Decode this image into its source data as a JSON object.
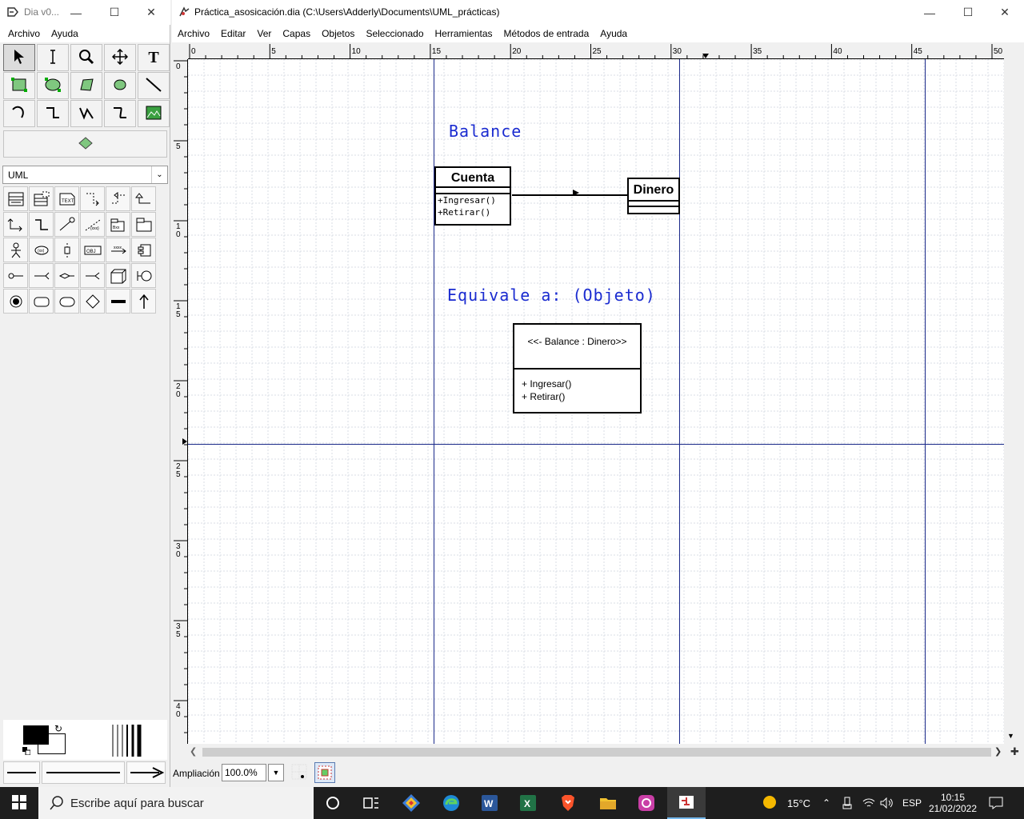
{
  "toolbox": {
    "title": "Dia v0...",
    "menu": [
      {
        "label": "Archivo"
      },
      {
        "label": "Ayuda"
      }
    ],
    "sheet": "UML",
    "tools": [
      {
        "icon": "pointer-icon"
      },
      {
        "icon": "text-cursor-icon"
      },
      {
        "icon": "magnify-icon"
      },
      {
        "icon": "move-icon"
      },
      {
        "icon": "text-tool-icon"
      },
      {
        "icon": "box-icon"
      },
      {
        "icon": "ellipse-icon"
      },
      {
        "icon": "polygon-icon"
      },
      {
        "icon": "beziergon-icon"
      },
      {
        "icon": "line-icon"
      },
      {
        "icon": "arc-icon"
      },
      {
        "icon": "zigzag-line-icon"
      },
      {
        "icon": "polyline-icon"
      },
      {
        "icon": "bezier-line-icon"
      },
      {
        "icon": "image-icon"
      }
    ],
    "wide_tool": "outline-icon"
  },
  "window": {
    "title": "Práctica_asosicación.dia (C:\\Users\\Adderly\\Documents\\UML_prácticas)",
    "menu": [
      {
        "label": "Archivo"
      },
      {
        "label": "Editar"
      },
      {
        "label": "Ver"
      },
      {
        "label": "Capas"
      },
      {
        "label": "Objetos"
      },
      {
        "label": "Seleccionado"
      },
      {
        "label": "Herramientas"
      },
      {
        "label": "Métodos de entrada"
      },
      {
        "label": "Ayuda"
      }
    ],
    "hruler_labels": [
      "0",
      "5",
      "10",
      "15",
      "20",
      "25",
      "30",
      "35",
      "40",
      "45",
      "50"
    ],
    "vruler_labels": [
      "0",
      "5",
      "10",
      "15",
      "20",
      "25",
      "30",
      "35",
      "40"
    ],
    "zoom_label": "Ampliación",
    "zoom_value": "100.0%"
  },
  "diagram": {
    "label1": "Balance",
    "label2": "Equivale a: (Objeto)",
    "class_cuenta": {
      "name": "Cuenta",
      "ops": [
        "+Ingresar()",
        "+Retirar()"
      ]
    },
    "class_dinero": {
      "name": "Dinero"
    },
    "object": {
      "name": "<<- Balance : Dinero>>",
      "ops": [
        "+ Ingresar()",
        "+ Retirar()"
      ]
    }
  },
  "taskbar": {
    "search_placeholder": "Escribe aquí para buscar",
    "temperature": "15°C",
    "language": "ESP",
    "time": "10:15",
    "date": "21/02/2022"
  }
}
